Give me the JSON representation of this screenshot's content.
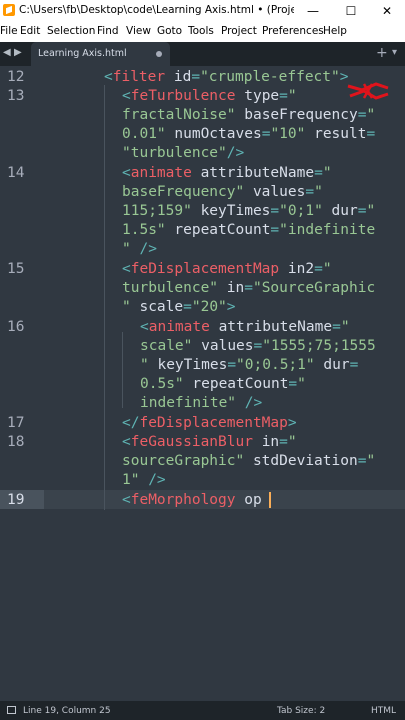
{
  "window": {
    "title": "C:\\Users\\fb\\Desktop\\code\\Learning Axis.html • (Project) - Su...",
    "controls": {
      "minimize": "—",
      "maximize": "☐",
      "close": "✕"
    }
  },
  "menu": [
    "File",
    "Edit",
    "Selection",
    "Find",
    "View",
    "Goto",
    "Tools",
    "Project",
    "Preferences",
    "Help"
  ],
  "tabs": [
    {
      "label": "Learning Axis.html",
      "modified": true
    }
  ],
  "tabbar": {
    "add": "+",
    "overflow": "▾",
    "nav_left": "◀",
    "nav_right": "▶"
  },
  "editor": {
    "line_numbers": [
      "12",
      "13",
      "14",
      "15",
      "16",
      "17",
      "18",
      "19"
    ],
    "active_line": "19",
    "code": {
      "l12": {
        "p1": "<",
        "tag": "filter",
        "sp1": " ",
        "attr": "id",
        "eq": "=",
        "val": "\"crumple-effect\"",
        "p2": ">"
      },
      "l13a": {
        "p1": "<",
        "tag": "feTurbulence",
        "sp1": " ",
        "attr": "type",
        "eq": "=",
        "val": "\""
      },
      "l13b": {
        "val1": "fractalNoise\"",
        "sp1": " ",
        "attr": "baseFrequency",
        "eq": "=",
        "val2": "\""
      },
      "l13c": {
        "val1": "0.01\"",
        "sp1": " ",
        "attr1": "numOctaves",
        "eq1": "=",
        "val2": "\"10\"",
        "sp2": " ",
        "attr2": "result",
        "eq2": "="
      },
      "l13d": {
        "val": "\"turbulence\"",
        "p": "/>"
      },
      "l14a": {
        "p1": "<",
        "tag": "animate",
        "sp1": " ",
        "attr": "attributeName",
        "eq": "=",
        "val": "\""
      },
      "l14b": {
        "val1": "baseFrequency\"",
        "sp1": " ",
        "attr": "values",
        "eq": "=",
        "val2": "\""
      },
      "l14c": {
        "val1": "115;159\"",
        "sp1": " ",
        "attr1": "keyTimes",
        "eq1": "=",
        "val2": "\"0;1\"",
        "sp2": " ",
        "attr2": "dur",
        "eq2": "=",
        "val3": "\""
      },
      "l14d": {
        "val1": "1.5s\"",
        "sp1": " ",
        "attr": "repeatCount",
        "eq": "=",
        "val2": "\"indefinite"
      },
      "l14e": {
        "val": "\"",
        "sp": " ",
        "p": "/>"
      },
      "l15a": {
        "p1": "<",
        "tag": "feDisplacementMap",
        "sp1": " ",
        "attr": "in2",
        "eq": "=",
        "val": "\""
      },
      "l15b": {
        "val1": "turbulence\"",
        "sp1": " ",
        "attr": "in",
        "eq": "=",
        "val2": "\"SourceGraphic"
      },
      "l15c": {
        "val1": "\"",
        "sp1": " ",
        "attr": "scale",
        "eq": "=",
        "val2": "\"20\"",
        "p": ">"
      },
      "l16a": {
        "p1": "<",
        "tag": "animate",
        "sp1": " ",
        "attr": "attributeName",
        "eq": "=",
        "val": "\""
      },
      "l16b": {
        "val1": "scale\"",
        "sp1": " ",
        "attr": "values",
        "eq": "=",
        "val2": "\"1555;75;1555"
      },
      "l16c": {
        "val1": "\"",
        "sp1": " ",
        "attr1": "keyTimes",
        "eq1": "=",
        "val2": "\"0;0.5;1\"",
        "sp2": " ",
        "attr2": "dur",
        "eq2": "="
      },
      "l16d": {
        "val1": "0.5s\"",
        "sp1": " ",
        "attr": "repeatCount",
        "eq": "=",
        "val2": "\""
      },
      "l16e": {
        "val": "indefinite\"",
        "sp": " ",
        "p": "/>"
      },
      "l17": {
        "p1": "</",
        "tag": "feDisplacementMap",
        "p2": ">"
      },
      "l18a": {
        "p1": "<",
        "tag": "feGaussianBlur",
        "sp1": " ",
        "attr": "in",
        "eq": "=",
        "val": "\""
      },
      "l18b": {
        "val1": "sourceGraphic\"",
        "sp1": " ",
        "attr": "stdDeviation",
        "eq": "=",
        "val2": "\""
      },
      "l18c": {
        "val": "1\"",
        "sp": " ",
        "p": "/>"
      },
      "l19": {
        "p1": "<",
        "tag": "feMorphology",
        "sp1": " ",
        "attr": "op"
      }
    }
  },
  "status": {
    "position": "Line 19, Column 25",
    "tab_size": "Tab Size: 2",
    "syntax": "HTML"
  },
  "colors": {
    "background": "#303841",
    "tag": "#ec5f66",
    "string": "#99c794",
    "punctuation": "#5fb4b4",
    "cursor": "#f9ae58"
  }
}
